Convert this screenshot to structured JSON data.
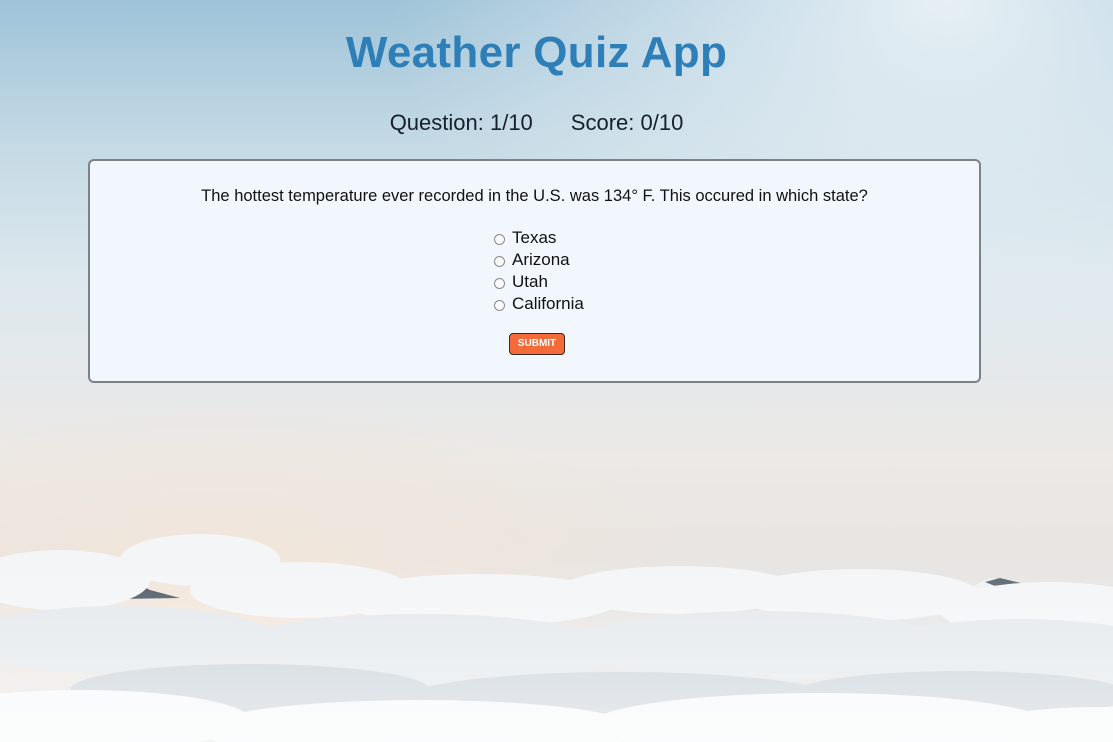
{
  "app": {
    "title": "Weather Quiz App"
  },
  "stats": {
    "question_label": "Question: 1/10",
    "score_label": "Score: 0/10"
  },
  "quiz": {
    "question": "The hottest temperature ever recorded in the U.S. was 134° F. This occured in which state?",
    "options": [
      "Texas",
      "Arizona",
      "Utah",
      "California"
    ],
    "submit_label": "SUBMIT"
  },
  "colors": {
    "title": "#2e7fb8",
    "submit_button": "#f26b38",
    "card_background": "#f1f7fd"
  },
  "background": {
    "icon": "cloud-sea-mountain-background"
  }
}
